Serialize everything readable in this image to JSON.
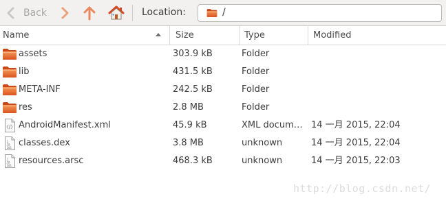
{
  "toolbar": {
    "back_label": "Back",
    "location_label": "Location:",
    "location_path": "/"
  },
  "columns": {
    "name": "Name",
    "size": "Size",
    "type": "Type",
    "modified": "Modified"
  },
  "files": [
    {
      "name": "assets",
      "size": "303.9 kB",
      "type": "Folder",
      "modified": "",
      "icon": "folder-icon"
    },
    {
      "name": "lib",
      "size": "431.5 kB",
      "type": "Folder",
      "modified": "",
      "icon": "folder-icon"
    },
    {
      "name": "META-INF",
      "size": "242.5 kB",
      "type": "Folder",
      "modified": "",
      "icon": "folder-icon"
    },
    {
      "name": "res",
      "size": "2.8 MB",
      "type": "Folder",
      "modified": "",
      "icon": "folder-icon"
    },
    {
      "name": "AndroidManifest.xml",
      "size": "45.9 kB",
      "type": "XML docum…",
      "modified": "14 一月 2015, 22:04",
      "icon": "xml-file-icon"
    },
    {
      "name": "classes.dex",
      "size": "3.8 MB",
      "type": "unknown",
      "modified": "14 一月 2015, 22:04",
      "icon": "binary-file-icon"
    },
    {
      "name": "resources.arsc",
      "size": "468.3 kB",
      "type": "unknown",
      "modified": "14 一月 2015, 22:03",
      "icon": "binary-file-icon"
    }
  ],
  "watermark": "http://blog.csdn.net/",
  "colors": {
    "folder": "#e8642a",
    "home_roof": "#d9461f",
    "nav_arrow": "#e8885f",
    "toolbar_bg": "#f2f1f0"
  }
}
